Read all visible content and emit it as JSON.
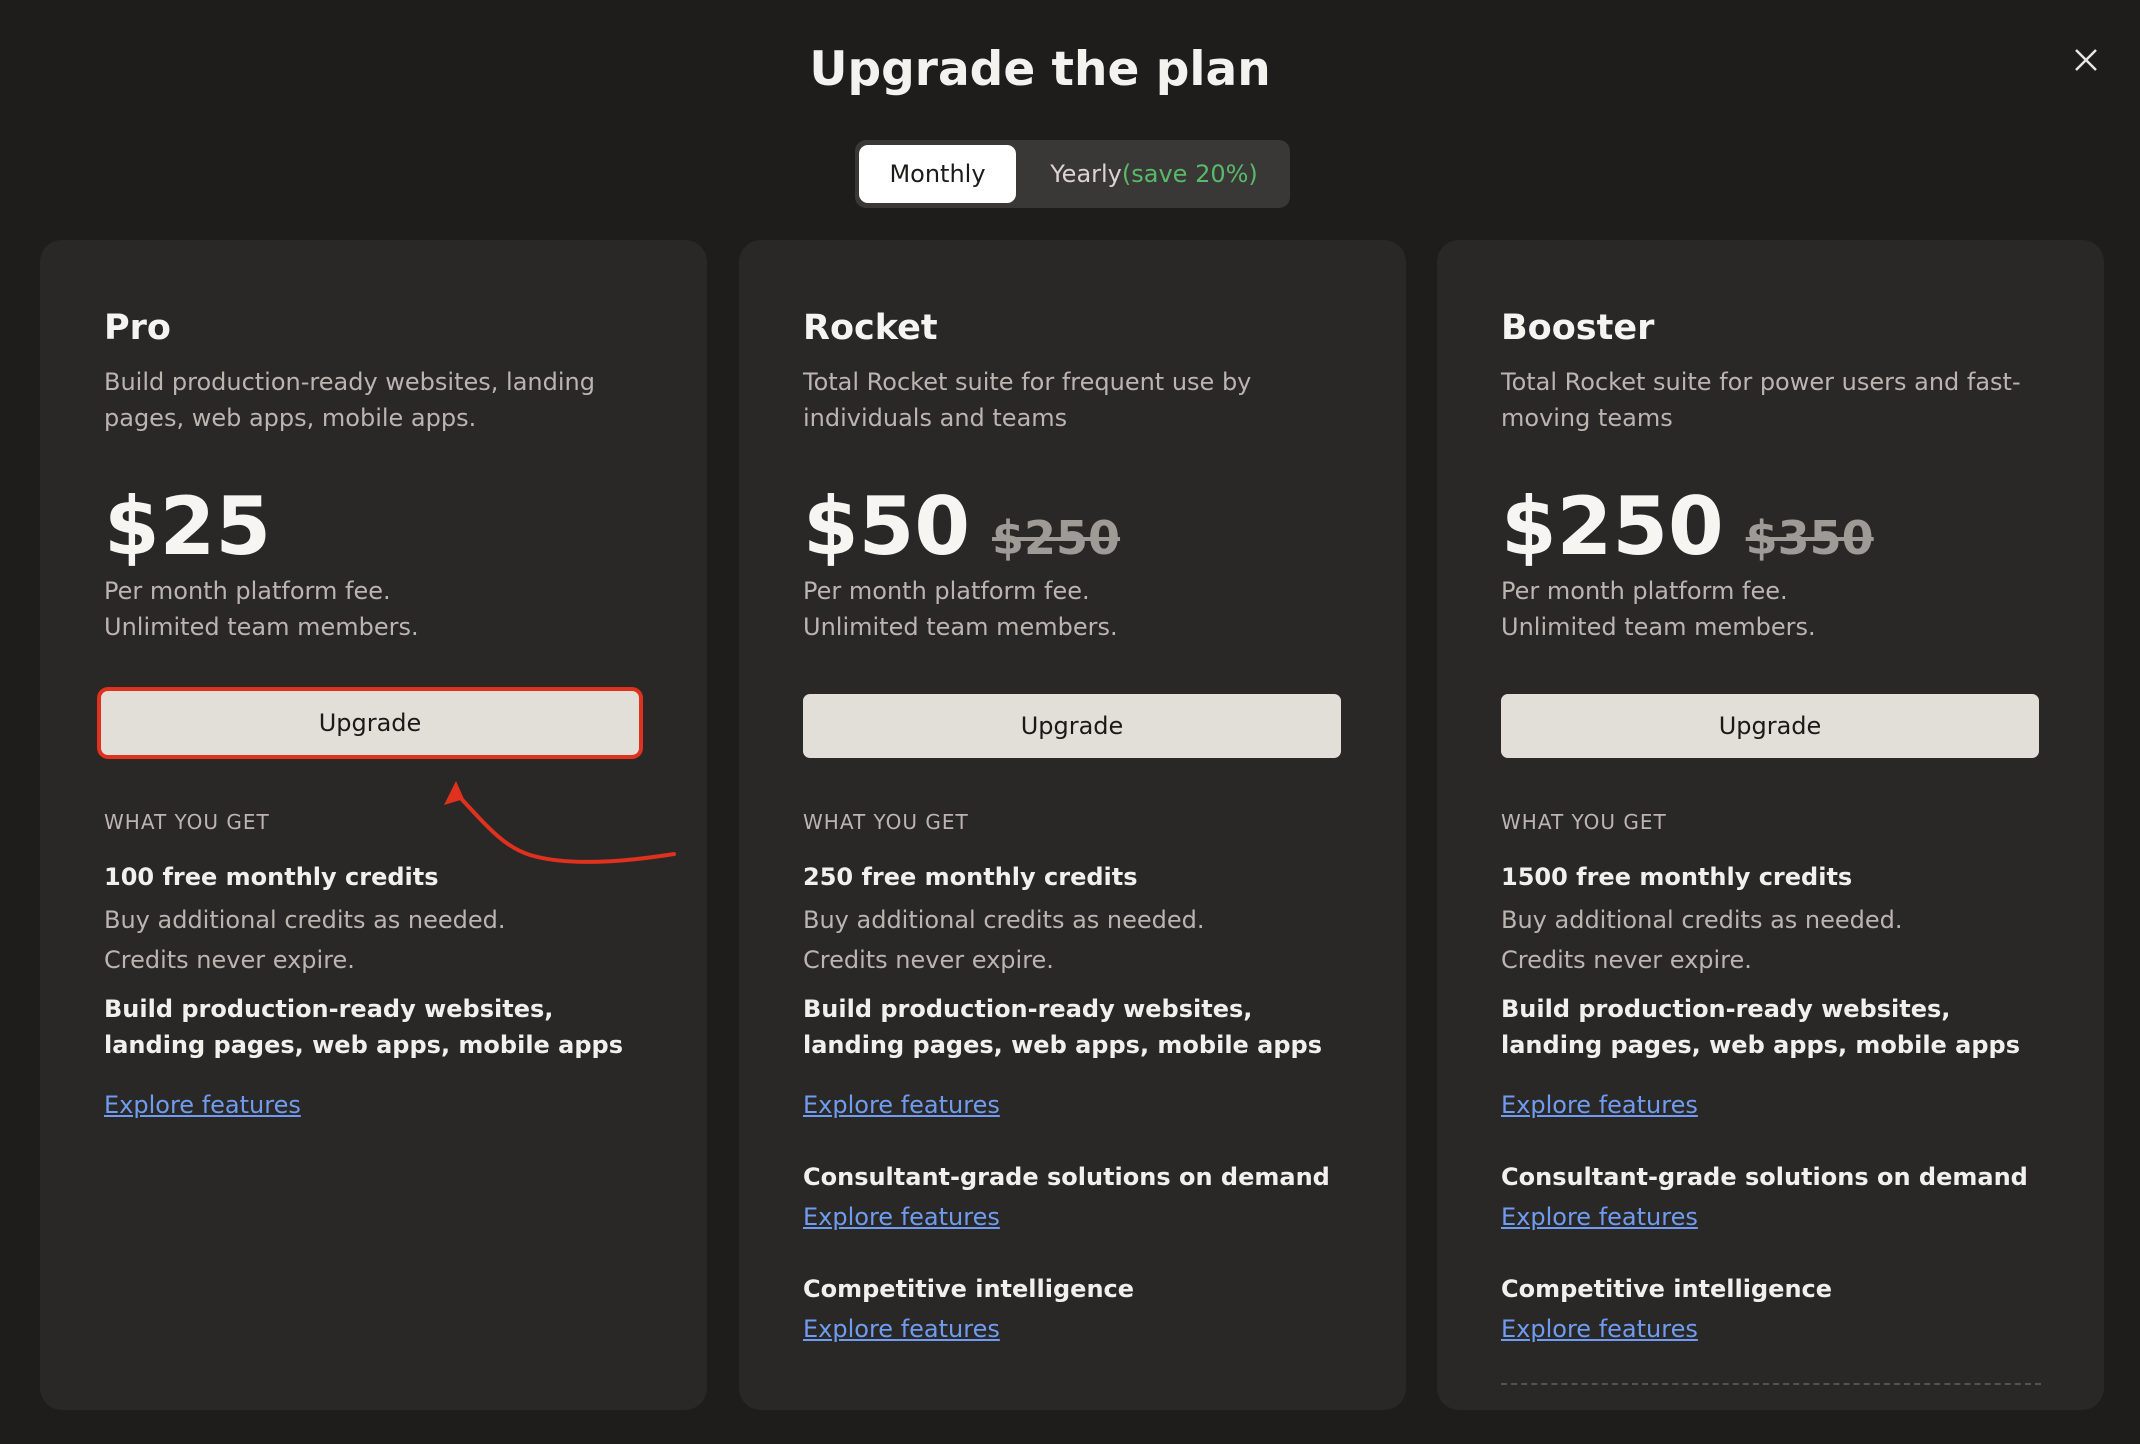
{
  "header": {
    "title": "Upgrade the plan",
    "close_icon": "close-icon"
  },
  "billing_toggle": {
    "monthly": "Monthly",
    "yearly": "Yearly",
    "yearly_save": "(save 20%)",
    "selected": "Monthly"
  },
  "plans": [
    {
      "name": "Pro",
      "description": "Build production-ready websites, landing pages, web apps, mobile apps.",
      "price": "$25",
      "old_price": "",
      "fee_line1": "Per month platform fee.",
      "fee_line2": "Unlimited team members.",
      "button": "Upgrade",
      "what_you_get": "WHAT YOU GET",
      "credits": "100 free monthly credits",
      "credits_note1": "Buy additional credits as needed.",
      "credits_note2": "Credits never expire.",
      "features": [
        {
          "title": "Build production-ready websites, landing pages, web apps, mobile apps",
          "link": "Explore features"
        }
      ]
    },
    {
      "name": "Rocket",
      "description": "Total Rocket suite for frequent use by individuals and teams",
      "price": "$50",
      "old_price": "$250",
      "fee_line1": "Per month platform fee.",
      "fee_line2": "Unlimited team members.",
      "button": "Upgrade",
      "what_you_get": "WHAT YOU GET",
      "credits": "250 free monthly credits",
      "credits_note1": "Buy additional credits as needed.",
      "credits_note2": "Credits never expire.",
      "features": [
        {
          "title": "Build production-ready websites, landing pages, web apps, mobile apps",
          "link": "Explore features"
        },
        {
          "title": "Consultant-grade solutions on demand",
          "link": "Explore features"
        },
        {
          "title": "Competitive intelligence",
          "link": "Explore features"
        }
      ]
    },
    {
      "name": "Booster",
      "description": "Total Rocket suite for power users and fast-moving teams",
      "price": "$250",
      "old_price": "$350",
      "fee_line1": "Per month platform fee.",
      "fee_line2": "Unlimited team members.",
      "button": "Upgrade",
      "what_you_get": "WHAT YOU GET",
      "credits": "1500 free monthly credits",
      "credits_note1": "Buy additional credits as needed.",
      "credits_note2": "Credits never expire.",
      "features": [
        {
          "title": "Build production-ready websites, landing pages, web apps, mobile apps",
          "link": "Explore features"
        },
        {
          "title": "Consultant-grade solutions on demand",
          "link": "Explore features"
        },
        {
          "title": "Competitive intelligence",
          "link": "Explore features"
        }
      ]
    }
  ],
  "colors": {
    "background": "#1e1d1c",
    "card": "#292826",
    "button": "#e2dfd9",
    "link": "#6f9cf0",
    "save_green": "#59b96b",
    "annotation_red": "#e0301e"
  }
}
